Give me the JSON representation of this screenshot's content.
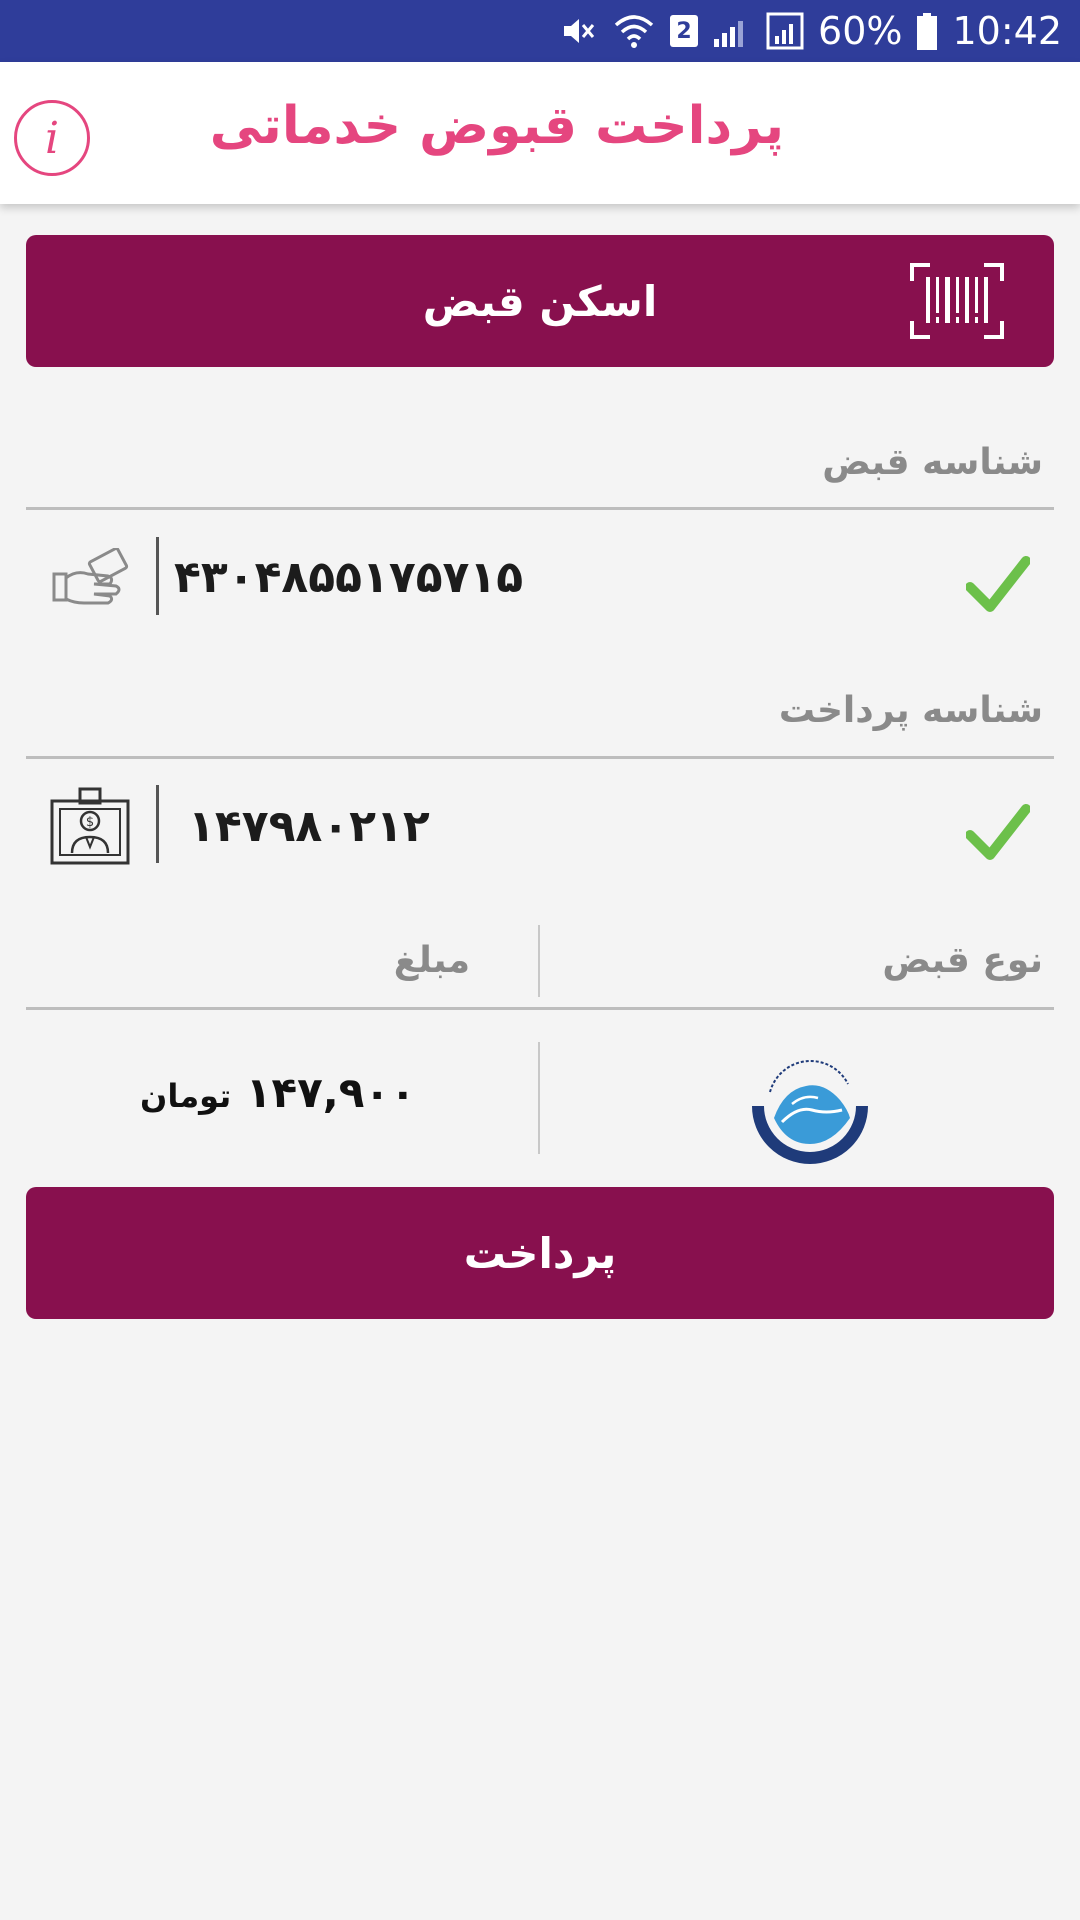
{
  "status_bar": {
    "sim_badge": "2",
    "battery": "60%",
    "time": "10:42"
  },
  "app_bar": {
    "title": "پرداخت قبوض خدماتی",
    "info_icon": "info-icon",
    "info_glyph": "i"
  },
  "scan_button": {
    "label": "اسکن قبض",
    "icon": "barcode-scan-icon"
  },
  "bill_id": {
    "label": "شناسه قبض",
    "value": "۴۳۰۴۸۵۵۱۷۵۷۱۵",
    "icon": "hand-card-icon",
    "valid_icon": "checkmark-icon"
  },
  "payment_id": {
    "label": "شناسه پرداخت",
    "value": "۱۴۷۹۸۰۲۱۲",
    "icon": "bill-money-icon",
    "valid_icon": "checkmark-icon"
  },
  "bill_type": {
    "label": "نوع قبض",
    "logo": "water-company-logo"
  },
  "amount": {
    "label": "مبلغ",
    "value": "۱۴۷,۹۰۰",
    "unit": "تومان"
  },
  "pay_button": {
    "label": "پرداخت"
  },
  "colors": {
    "status_bar": "#2f3d9a",
    "accent_pink": "#e5467f",
    "primary_button": "#88104e",
    "check_green": "#6cc04a",
    "background": "#f4f4f4"
  }
}
